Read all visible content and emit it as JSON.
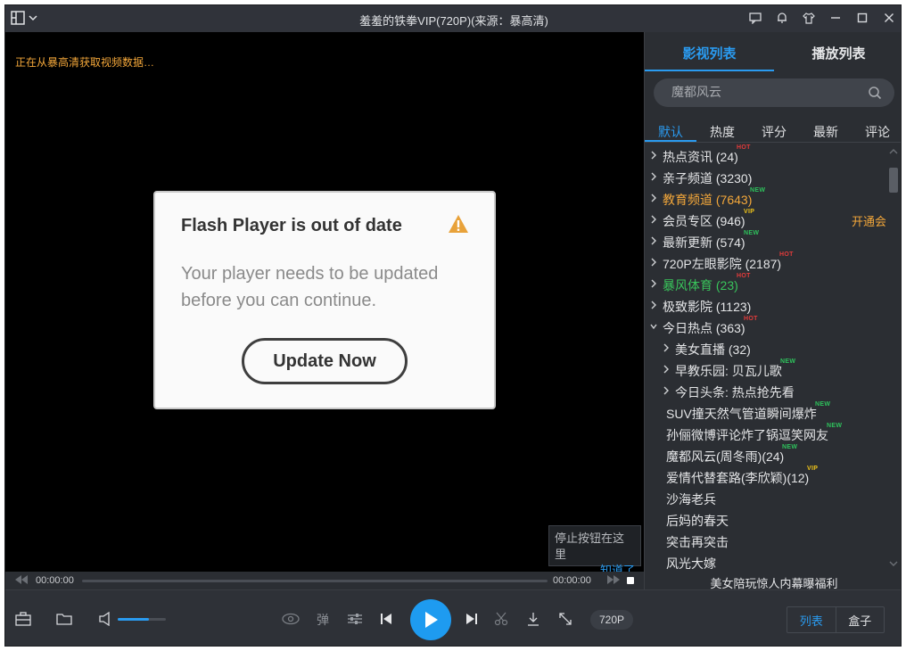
{
  "window": {
    "title": "羞羞的铁拳VIP(720P)(来源：暴高清)"
  },
  "player": {
    "loading_text": "正在从暴高清获取视频数据…",
    "flash": {
      "title": "Flash Player is out of date",
      "message": "Your player needs to be updated before you can continue.",
      "button": "Update Now"
    },
    "tooltip": {
      "text": "停止按钮在这里",
      "link": "知道了"
    },
    "time_current": "00:00:00",
    "time_total": "00:00:00",
    "progress": 0,
    "volume": 0.65
  },
  "panel": {
    "tabs": [
      "影视列表",
      "播放列表"
    ],
    "search_placeholder": "魔都风云",
    "sort_tabs": [
      "默认",
      "热度",
      "评分",
      "最新",
      "评论"
    ],
    "tree": [
      {
        "label": "热点资讯 (24)",
        "level": 0,
        "chevron": "right",
        "badge": "HOT",
        "color": ""
      },
      {
        "label": "亲子频道 (3230)",
        "level": 0,
        "chevron": "right",
        "badge": "",
        "color": ""
      },
      {
        "label": "教育频道 (7643)",
        "level": 0,
        "chevron": "right",
        "badge": "NEW",
        "color": "orange"
      },
      {
        "label": "会员专区 (946)",
        "level": 0,
        "chevron": "right",
        "badge": "VIP",
        "color": "",
        "extra": "开通会员"
      },
      {
        "label": "最新更新 (574)",
        "level": 0,
        "chevron": "right",
        "badge": "NEW",
        "color": ""
      },
      {
        "label": "720P左眼影院 (2187)",
        "level": 0,
        "chevron": "right",
        "badge": "HOT",
        "color": ""
      },
      {
        "label": "暴风体育 (23)",
        "level": 0,
        "chevron": "right",
        "badge": "HOT",
        "color": "green"
      },
      {
        "label": "极致影院 (1123)",
        "level": 0,
        "chevron": "right",
        "badge": "",
        "color": ""
      },
      {
        "label": "今日热点 (363)",
        "level": 0,
        "chevron": "down",
        "badge": "HOT",
        "color": ""
      },
      {
        "label": "美女直播 (32)",
        "level": 1,
        "chevron": "right",
        "badge": "",
        "color": ""
      },
      {
        "label": "早教乐园: 贝瓦儿歌",
        "level": 1,
        "chevron": "right",
        "badge": "NEW",
        "color": ""
      },
      {
        "label": "今日头条: 热点抢先看",
        "level": 1,
        "chevron": "right",
        "badge": "",
        "color": ""
      },
      {
        "label": "SUV撞天然气管道瞬间爆炸",
        "level": 2,
        "chevron": "",
        "badge": "NEW",
        "color": ""
      },
      {
        "label": "孙俪微博评论炸了锅逗笑网友",
        "level": 2,
        "chevron": "",
        "badge": "NEW",
        "color": ""
      },
      {
        "label": "魔都风云(周冬雨)(24)",
        "level": 2,
        "chevron": "",
        "badge": "NEW",
        "color": ""
      },
      {
        "label": "爱情代替套路(李欣颖)(12)",
        "level": 2,
        "chevron": "",
        "badge": "VIP",
        "color": ""
      },
      {
        "label": "沙海老兵",
        "level": 2,
        "chevron": "",
        "badge": "",
        "color": ""
      },
      {
        "label": "后妈的春天",
        "level": 2,
        "chevron": "",
        "badge": "",
        "color": ""
      },
      {
        "label": "突击再突击",
        "level": 2,
        "chevron": "",
        "badge": "",
        "color": ""
      },
      {
        "label": "风光大嫁",
        "level": 2,
        "chevron": "",
        "badge": "",
        "color": ""
      }
    ],
    "promo": "美女陪玩惊人内幕曝福利"
  },
  "toolbar": {
    "danmaku_label": "弹",
    "quality": "720P",
    "view_list": "列表",
    "view_box": "盒子"
  },
  "colors": {
    "accent": "#2a9bf0",
    "background": "#2b2e33",
    "hot": "#e23b3b",
    "new": "#2ec15c",
    "vip": "#f0c419",
    "orange": "#f3a73a"
  }
}
